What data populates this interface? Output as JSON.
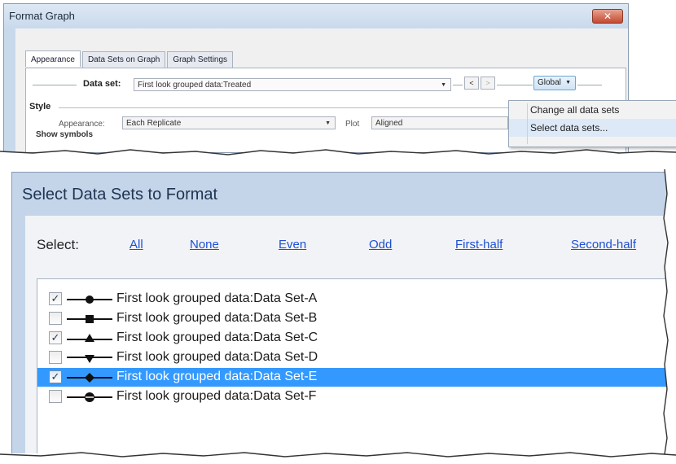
{
  "format_graph": {
    "title": "Format Graph",
    "close_glyph": "✕",
    "tabs": [
      {
        "label": "Appearance",
        "active": true
      },
      {
        "label": "Data Sets on Graph",
        "active": false
      },
      {
        "label": "Graph Settings",
        "active": false
      }
    ],
    "data_set_label": "Data set:",
    "data_set_value": "First look grouped data:Treated",
    "prev_glyph": "<",
    "next_glyph": ">",
    "global_button": "Global",
    "style_heading": "Style",
    "appearance_label": "Appearance:",
    "appearance_value": "Each Replicate",
    "plot_label": "Plot",
    "plot_value": "Aligned",
    "show_symbols_label": "Show symbols",
    "dropdown_arrow": "▼",
    "global_menu": [
      "Change all data sets",
      "Select data sets..."
    ]
  },
  "select_dialog": {
    "title": "Select Data Sets to Format",
    "select_label": "Select:",
    "links": [
      "All",
      "None",
      "Even",
      "Odd",
      "First-half",
      "Second-half"
    ],
    "check_glyph": "✓",
    "items": [
      {
        "label": "First look grouped data:Data Set-A",
        "checked": true,
        "symbol": "circle-icon",
        "selected": false
      },
      {
        "label": "First look grouped data:Data Set-B",
        "checked": false,
        "symbol": "square-icon",
        "selected": false
      },
      {
        "label": "First look grouped data:Data Set-C",
        "checked": true,
        "symbol": "triangle-up-icon",
        "selected": false
      },
      {
        "label": "First look grouped data:Data Set-D",
        "checked": false,
        "symbol": "triangle-down-icon",
        "selected": false
      },
      {
        "label": "First look grouped data:Data Set-E",
        "checked": true,
        "symbol": "diamond-icon",
        "selected": true
      },
      {
        "label": "First look grouped data:Data Set-F",
        "checked": false,
        "symbol": "circle-plus-icon",
        "selected": false
      }
    ]
  },
  "colors": {
    "selection": "#3399ff",
    "link": "#1f4fd1",
    "title_bar": "#c4d5ea"
  }
}
